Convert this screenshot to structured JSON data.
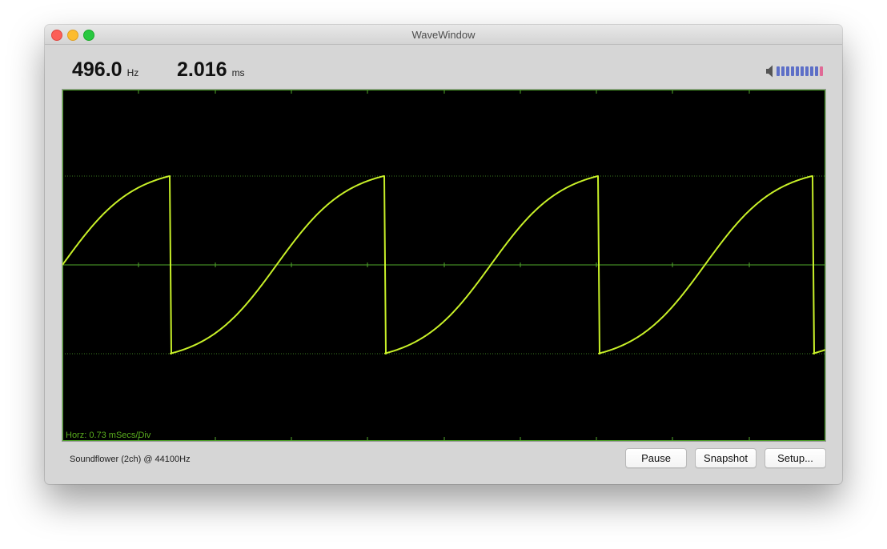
{
  "window": {
    "title": "WaveWindow"
  },
  "readouts": {
    "frequency": {
      "value": "496.0",
      "unit": "Hz"
    },
    "period": {
      "value": "2.016",
      "unit": "ms"
    }
  },
  "volume": {
    "icon": "speaker-icon",
    "level": 0.9
  },
  "scope": {
    "horizontal_label": "Horz: 0.73 mSecs/Div",
    "trace_color": "#c8f028",
    "grid_color": "#4fa82a",
    "background": "#000000"
  },
  "footer": {
    "source": "Soundflower (2ch) @ 44100Hz",
    "buttons": {
      "pause": "Pause",
      "snapshot": "Snapshot",
      "setup": "Setup..."
    }
  }
}
